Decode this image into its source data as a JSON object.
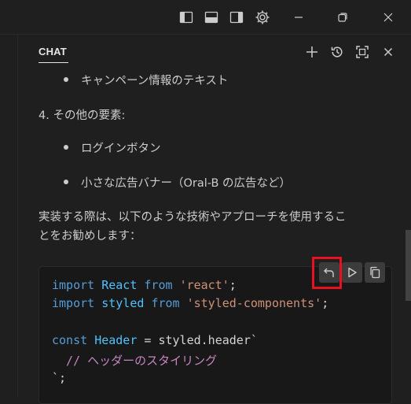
{
  "titlebar": {
    "icons": [
      "toggle-primary-sidebar-icon",
      "toggle-panel-icon",
      "toggle-secondary-sidebar-icon",
      "customize-layout-icon",
      "minimize-icon",
      "restore-icon",
      "close-icon"
    ]
  },
  "chat": {
    "title": "CHAT",
    "header_icons": [
      "new-chat-icon",
      "history-icon",
      "maximize-icon",
      "close-icon"
    ]
  },
  "content": {
    "bullet_1": "キャンペーン情報のテキスト",
    "section_4": "4. その他の要素:",
    "bullet_2": "ログインボタン",
    "bullet_3": "小さな広告バナー（Oral-B の広告など）",
    "para_line_1": "実装する際は、以下のような技術やアプローチを使用するこ",
    "para_line_2": "とをお勧めします："
  },
  "code": {
    "line1": {
      "kw": "import",
      "id": "React",
      "from": "from",
      "str": "'react'",
      "end": ";"
    },
    "line2": {
      "kw": "import",
      "id": "styled",
      "from": "from",
      "str": "'styled-components'",
      "end": ";"
    },
    "line3": {
      "kw": "const",
      "id": "Header",
      "rest": " = styled.header`"
    },
    "line4": {
      "comment": "  // ヘッダーのスタイリング"
    },
    "line5": {
      "text": "`;"
    }
  },
  "code_actions": [
    "apply-undo-icon",
    "insert-at-cursor-icon",
    "copy-icon"
  ],
  "colors": {
    "background": "#1f1f1f",
    "code_background": "#181818",
    "keyword": "#569cd6",
    "identifier": "#4fc1ff",
    "string": "#ce9178",
    "comment": "#c586c0",
    "highlight": "#e81123"
  }
}
